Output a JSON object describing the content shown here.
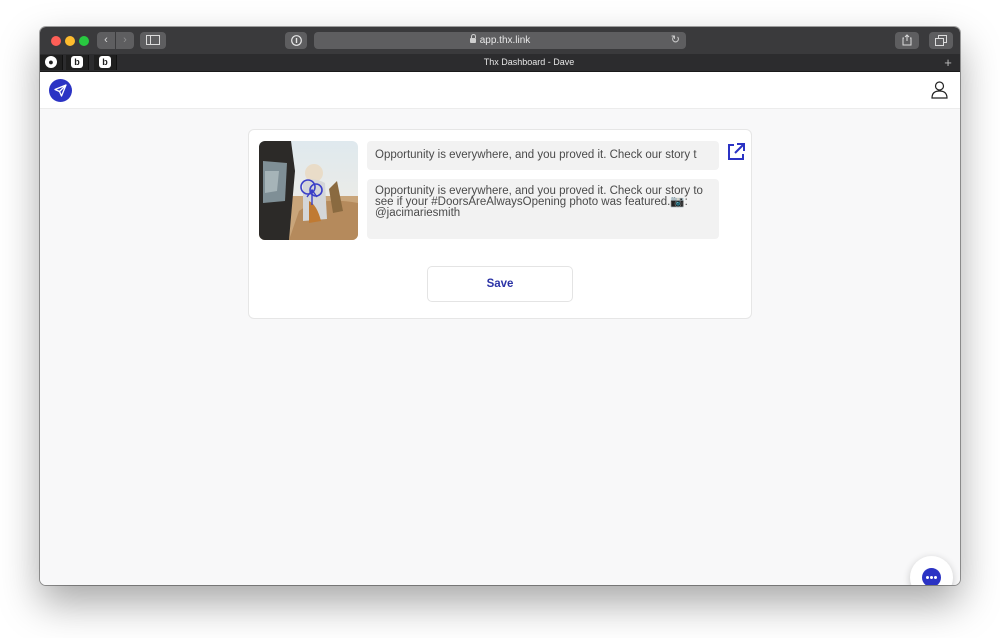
{
  "browser": {
    "url": "app.thx.link",
    "tab_title": "Thx Dashboard - Dave",
    "nav_back_glyph": "‹",
    "nav_forward_glyph": "›",
    "new_tab_glyph": "+",
    "reload_glyph": "↻",
    "pinned_tabs": [
      {
        "icon": "pinned-tab-icon",
        "glyph": "●"
      },
      {
        "icon": "b-logo-icon",
        "glyph": "b"
      },
      {
        "icon": "b-logo-icon",
        "glyph": "b"
      }
    ]
  },
  "header": {
    "logo_icon": "paper-plane-icon",
    "user_icon": "user-icon",
    "accent": "#2b33c4"
  },
  "card": {
    "title_value": "Opportunity is everywhere, and you proved it. Check our story t",
    "description_value": "Opportunity is everywhere, and you proved it. Check our story to see if your #DoorsAreAlwaysOpening photo was featured.📷: @jacimariesmith",
    "external_link_icon": "external-link-icon",
    "save_label": "Save"
  },
  "chat": {
    "icon": "chat-bubble-icon"
  }
}
